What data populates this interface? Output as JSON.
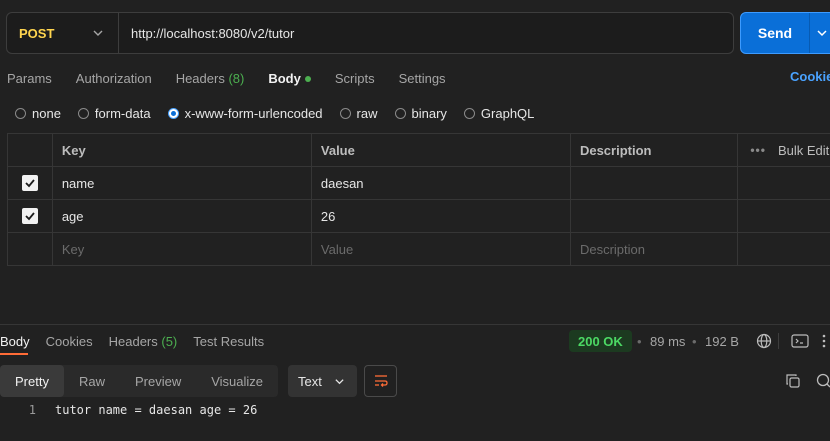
{
  "request": {
    "method": "POST",
    "url": "http://localhost:8080/v2/tutor",
    "send_label": "Send"
  },
  "request_tabs": [
    {
      "label": "Params",
      "active": false
    },
    {
      "label": "Authorization",
      "active": false
    },
    {
      "label": "Headers",
      "count": "(8)",
      "active": false
    },
    {
      "label": "Body",
      "active": true
    },
    {
      "label": "Scripts",
      "active": false
    },
    {
      "label": "Settings",
      "active": false
    }
  ],
  "cookies_label": "Cookies",
  "body_types": [
    {
      "label": "none",
      "checked": false
    },
    {
      "label": "form-data",
      "checked": false
    },
    {
      "label": "x-www-form-urlencoded",
      "checked": true
    },
    {
      "label": "raw",
      "checked": false
    },
    {
      "label": "binary",
      "checked": false
    },
    {
      "label": "GraphQL",
      "checked": false
    }
  ],
  "params_table": {
    "headers": {
      "key": "Key",
      "value": "Value",
      "description": "Description",
      "bulk_edit": "Bulk Edit",
      "more": "•••"
    },
    "rows": [
      {
        "checked": true,
        "key": "name",
        "value": "daesan",
        "description": ""
      },
      {
        "checked": true,
        "key": "age",
        "value": "26",
        "description": ""
      }
    ],
    "placeholders": {
      "key": "Key",
      "value": "Value",
      "description": "Description"
    }
  },
  "response": {
    "tabs": [
      {
        "label": "Body",
        "active": true
      },
      {
        "label": "Cookies",
        "active": false
      },
      {
        "label": "Headers",
        "count": "(5)",
        "active": false
      },
      {
        "label": "Test Results",
        "active": false
      }
    ],
    "status": "200 OK",
    "time": "89 ms",
    "size": "192 B",
    "view_tabs": [
      "Pretty",
      "Raw",
      "Preview",
      "Visualize"
    ],
    "active_view": "Pretty",
    "format": "Text",
    "lines": [
      {
        "number": "1",
        "text": "tutor name = daesan age = 26"
      }
    ]
  },
  "colors": {
    "accent_blue": "#0a6fd8",
    "method_yellow": "#ffd54f",
    "success_green": "#4caf50",
    "tab_underline": "#ff6c37"
  }
}
